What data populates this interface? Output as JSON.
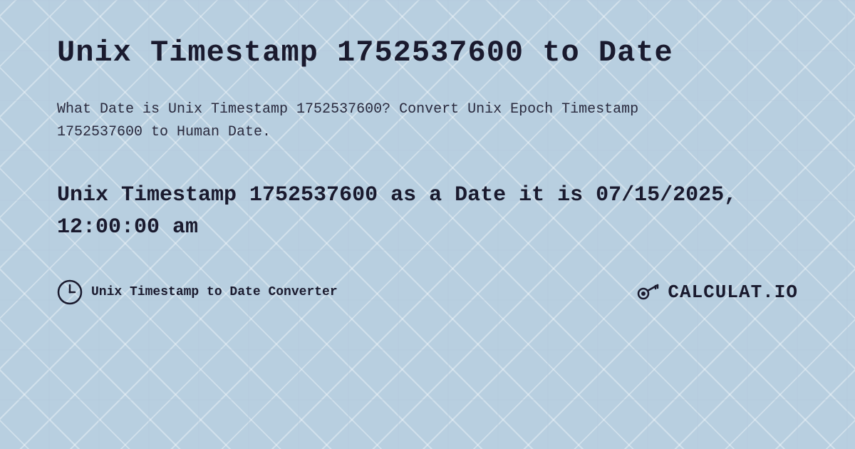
{
  "page": {
    "title": "Unix Timestamp 1752537600 to Date",
    "description": "What Date is Unix Timestamp 1752537600? Convert Unix Epoch Timestamp 1752537600 to Human Date.",
    "result": "Unix Timestamp 1752537600 as a Date it is 07/15/2025, 12:00:00 am",
    "footer": {
      "label": "Unix Timestamp to Date Converter",
      "logo": "CALCULAT.IO"
    },
    "colors": {
      "background": "#b8cfe0",
      "text_dark": "#1a1a2e",
      "accent": "#1a1a2e"
    }
  }
}
